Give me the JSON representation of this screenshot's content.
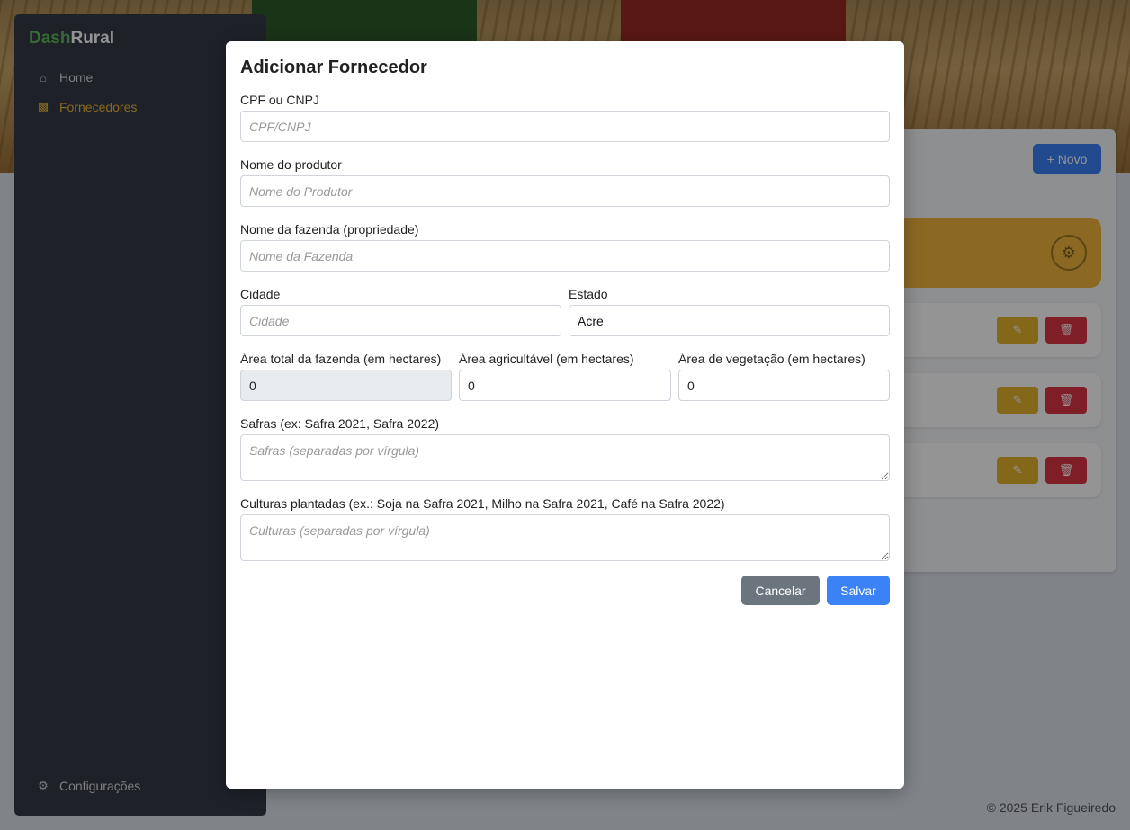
{
  "brand": {
    "part1": "Dash",
    "part2": "Rural"
  },
  "sidebar": {
    "items": [
      {
        "label": "Home",
        "icon": "home-icon"
      },
      {
        "label": "Fornecedores",
        "icon": "truck-icon"
      }
    ],
    "footer_item": {
      "label": "Configurações",
      "icon": "gear-icon"
    }
  },
  "main": {
    "new_button": "+ Novo",
    "footer": "© 2025 Erik Figueiredo"
  },
  "modal": {
    "title": "Adicionar Fornecedor",
    "fields": {
      "doc": {
        "label": "CPF ou CNPJ",
        "placeholder": "CPF/CNPJ"
      },
      "producer": {
        "label": "Nome do produtor",
        "placeholder": "Nome do Produtor"
      },
      "farm": {
        "label": "Nome da fazenda (propriedade)",
        "placeholder": "Nome da Fazenda"
      },
      "city": {
        "label": "Cidade",
        "placeholder": "Cidade"
      },
      "state": {
        "label": "Estado",
        "value": "Acre"
      },
      "total_area": {
        "label": "Área total da fazenda (em hectares)",
        "value": "0"
      },
      "arable_area": {
        "label": "Área agricultável (em hectares)",
        "value": "0"
      },
      "vegetation_area": {
        "label": "Área de vegetação (em hectares)",
        "value": "0"
      },
      "harvests": {
        "label": "Safras (ex: Safra 2021, Safra 2022)",
        "placeholder": "Safras (separadas por vírgula)"
      },
      "crops": {
        "label": "Culturas plantadas (ex.: Soja na Safra 2021, Milho na Safra 2021, Café na Safra 2022)",
        "placeholder": "Culturas (separadas por vírgula)"
      }
    },
    "cancel_label": "Cancelar",
    "save_label": "Salvar"
  },
  "colors": {
    "accent": "#3b82f6",
    "sidebar_bg": "#343a46",
    "active_nav": "#f0b73a",
    "warning": "#e6b12e",
    "danger": "#dc3545"
  }
}
